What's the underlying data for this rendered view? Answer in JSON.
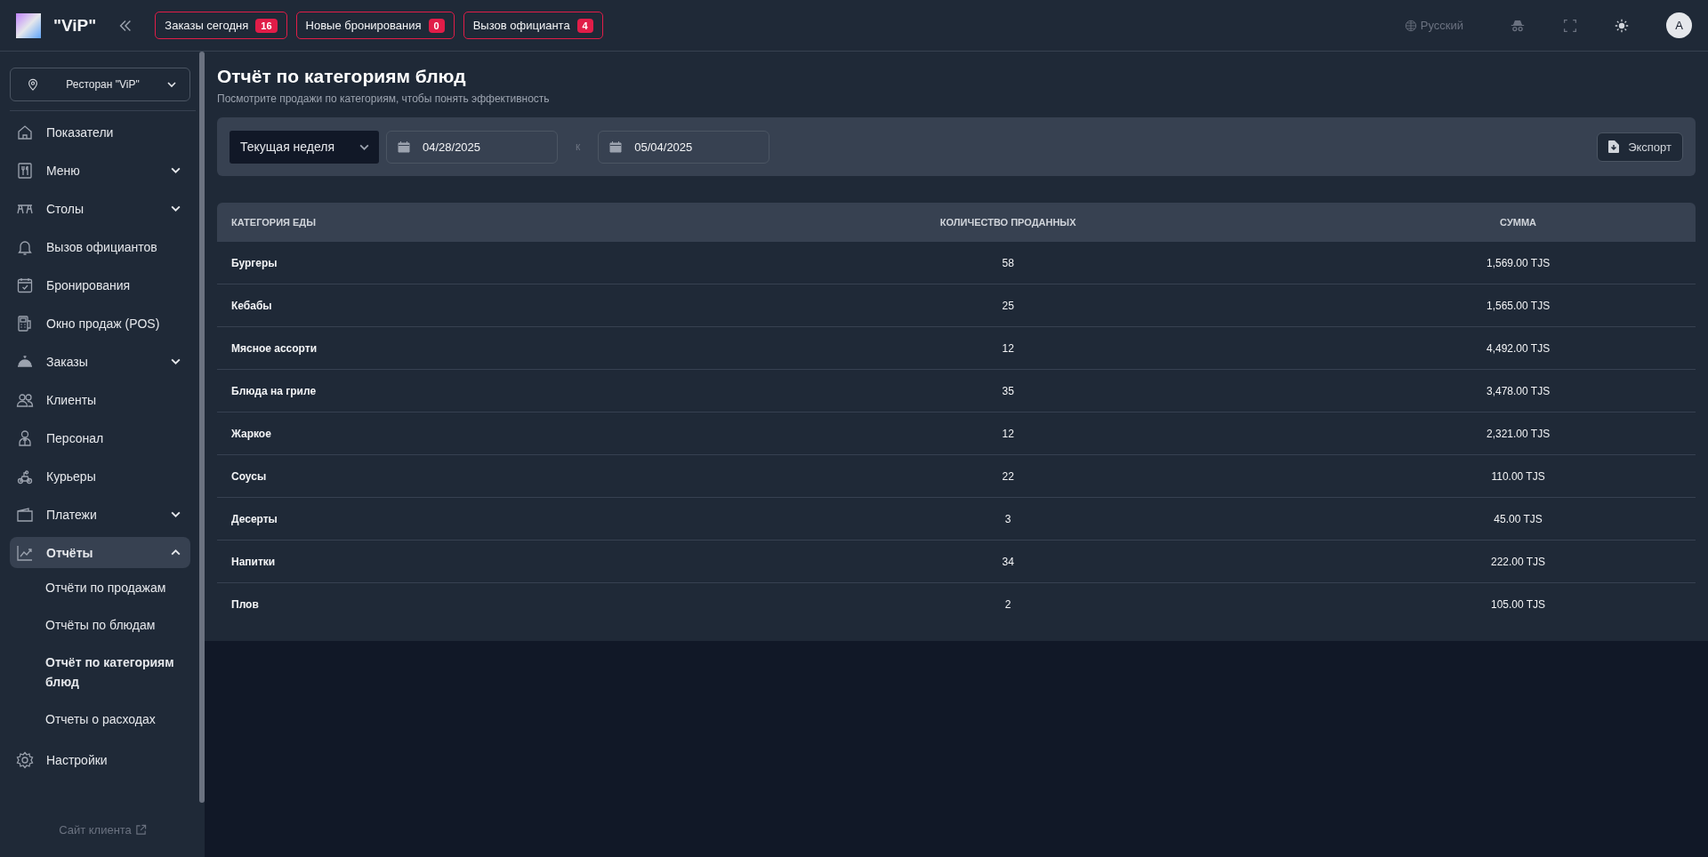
{
  "header": {
    "brand": "\"ViP\"",
    "badges": [
      {
        "label": "Заказы сегодня",
        "count": "16"
      },
      {
        "label": "Новые бронирования",
        "count": "0"
      },
      {
        "label": "Вызов официанта",
        "count": "4"
      }
    ],
    "language": "Русский",
    "avatar": "A"
  },
  "sidebar": {
    "restaurant": "Ресторан \"ViP\"",
    "items": [
      {
        "label": "Показатели",
        "selected": false
      },
      {
        "label": "Меню",
        "selected": false,
        "expanded": false
      },
      {
        "label": "Столы",
        "selected": false,
        "expanded": false
      },
      {
        "label": "Вызов официантов",
        "selected": false
      },
      {
        "label": "Бронирования",
        "selected": false
      },
      {
        "label": "Окно продаж (POS)",
        "selected": false
      },
      {
        "label": "Заказы",
        "selected": false,
        "expanded": false
      },
      {
        "label": "Клиенты",
        "selected": false
      },
      {
        "label": "Персонал",
        "selected": false
      },
      {
        "label": "Курьеры",
        "selected": false
      },
      {
        "label": "Платежи",
        "selected": false,
        "expanded": false
      },
      {
        "label": "Отчёты",
        "selected": true,
        "expanded": true,
        "children": [
          {
            "label": "Отчёти по продажам",
            "selected": false
          },
          {
            "label": "Отчёты по блюдам",
            "selected": false
          },
          {
            "label": "Отчёт по категориям блюд",
            "selected": true
          },
          {
            "label": "Отчеты о расходах",
            "selected": false
          }
        ]
      },
      {
        "label": "Настройки",
        "selected": false
      }
    ],
    "client_site": "Сайт клиента"
  },
  "page": {
    "title": "Отчёт по категориям блюд",
    "subtitle": "Посмотрите продажи по категориям, чтобы понять эффективность"
  },
  "filters": {
    "period": "Текущая неделя",
    "date_from": "04/28/2025",
    "separator": "к",
    "date_to": "05/04/2025",
    "export": "Экспорт"
  },
  "table": {
    "columns": [
      "КАТЕГОРИЯ ЕДЫ",
      "КОЛИЧЕСТВО ПРОДАННЫХ",
      "СУММА"
    ],
    "rows": [
      [
        "Бургеры",
        "58",
        "1,569.00 TJS"
      ],
      [
        "Кебабы",
        "25",
        "1,565.00 TJS"
      ],
      [
        "Мясное ассорти",
        "12",
        "4,492.00 TJS"
      ],
      [
        "Блюда на гриле",
        "35",
        "3,478.00 TJS"
      ],
      [
        "Жаркое",
        "12",
        "2,321.00 TJS"
      ],
      [
        "Соусы",
        "22",
        "110.00 TJS"
      ],
      [
        "Десерты",
        "3",
        "45.00 TJS"
      ],
      [
        "Напитки",
        "34",
        "222.00 TJS"
      ],
      [
        "Плов",
        "2",
        "105.00 TJS"
      ]
    ]
  }
}
